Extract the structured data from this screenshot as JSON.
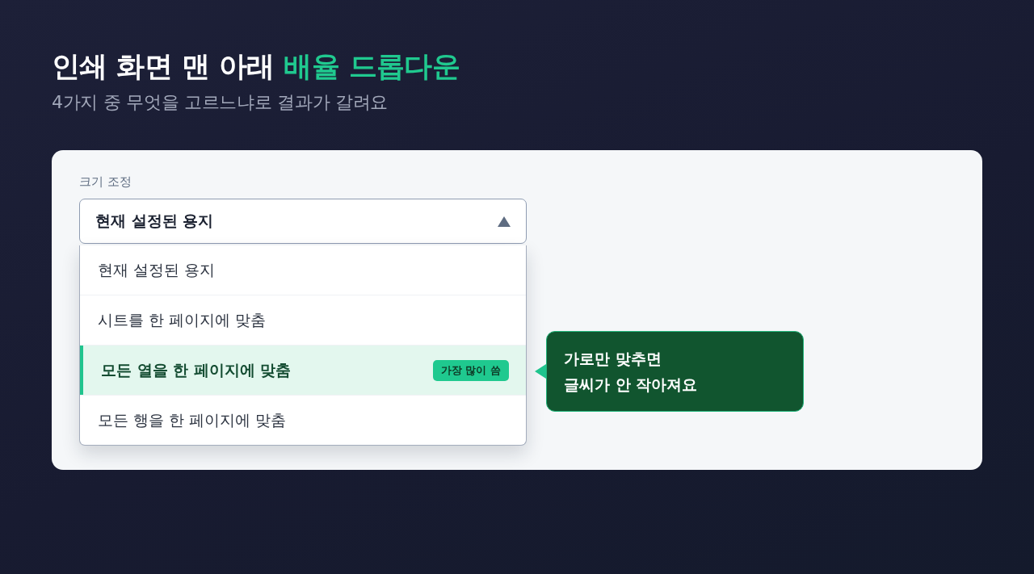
{
  "title": {
    "text": "인쇄 화면 맨 아래",
    "highlight": "배율 드롭다운"
  },
  "subtitle": "4가지 중 무엇을 고르느냐로 결과가 갈려요",
  "field": {
    "label": "크기 조정",
    "value": "현재 설정된 용지",
    "expanded": true
  },
  "options": [
    {
      "label": "현재 설정된 용지",
      "selected": false
    },
    {
      "label": "시트를 한 페이지에 맞춤",
      "selected": false
    },
    {
      "label": "모든 열을 한 페이지에 맞춤",
      "selected": true,
      "badge": "가장 많이 씀"
    },
    {
      "label": "모든 행을 한 페이지에 맞춤",
      "selected": false
    }
  ],
  "callout": {
    "lines": [
      "가로만 맞추면",
      "글씨가 안 작아져요"
    ]
  }
}
